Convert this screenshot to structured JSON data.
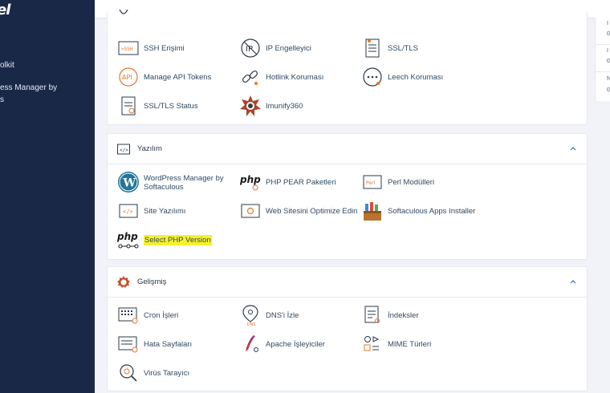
{
  "sidebar": {
    "logo": "el",
    "items": [
      {
        "label": "olkit"
      },
      {
        "label": "ess Manager by"
      },
      {
        "label": "s"
      }
    ]
  },
  "right_widget": {
    "lines": [
      "I",
      "0",
      "I",
      "0",
      "N",
      "0"
    ]
  },
  "security": {
    "items": [
      {
        "label": "SSH Erişimi",
        "icon": "ssh-icon"
      },
      {
        "label": "IP Engelleyici",
        "icon": "ip-block-icon"
      },
      {
        "label": "SSL/TLS",
        "icon": "ssl-icon"
      },
      {
        "label": "Manage API Tokens",
        "icon": "api-icon"
      },
      {
        "label": "Hotlink Koruması",
        "icon": "link-icon"
      },
      {
        "label": "Leech Koruması",
        "icon": "leech-icon"
      },
      {
        "label": "SSL/TLS Status",
        "icon": "ssl-status-icon"
      },
      {
        "label": "Imunify360",
        "icon": "imunify-icon"
      }
    ]
  },
  "software": {
    "title": "Yazılım",
    "items": [
      {
        "label": "WordPress Manager by Softaculous",
        "icon": "wordpress-icon"
      },
      {
        "label": "PHP PEAR Paketleri",
        "icon": "php-pear-icon"
      },
      {
        "label": "Perl Modülleri",
        "icon": "perl-icon"
      },
      {
        "label": "Site Yazılımı",
        "icon": "code-icon"
      },
      {
        "label": "Web Sitesini Optimize Edin",
        "icon": "optimize-icon"
      },
      {
        "label": "Softaculous Apps Installer",
        "icon": "softaculous-icon"
      },
      {
        "label": "Select PHP Version",
        "icon": "php-version-icon"
      }
    ]
  },
  "advanced": {
    "title": "Gelişmiş",
    "items": [
      {
        "label": "Cron İşleri",
        "icon": "cron-icon"
      },
      {
        "label": "DNS'i İzle",
        "icon": "dns-icon"
      },
      {
        "label": "İndeksler",
        "icon": "index-icon"
      },
      {
        "label": "Hata Sayfaları",
        "icon": "error-pages-icon"
      },
      {
        "label": "Apache İşleyiciler",
        "icon": "apache-icon"
      },
      {
        "label": "MIME Türleri",
        "icon": "mime-icon"
      },
      {
        "label": "Virüs Tarayıcı",
        "icon": "virus-icon"
      }
    ]
  },
  "colors": {
    "sidebar": "#1a2847",
    "accent_orange": "#e8762b",
    "icon_dark": "#2b3a4a",
    "highlight": "#f6f22b"
  }
}
